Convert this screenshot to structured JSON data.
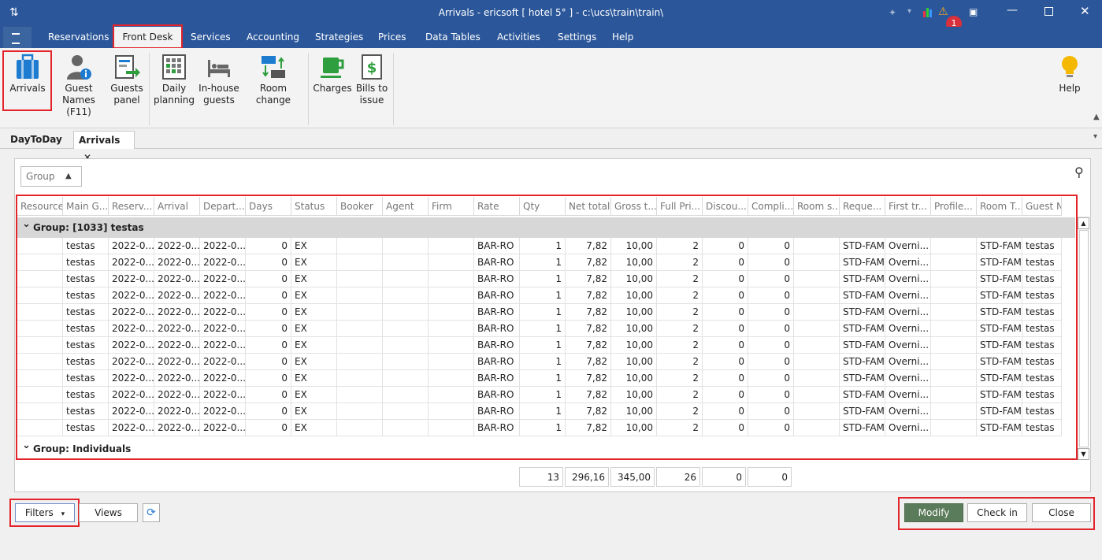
{
  "window": {
    "title": "Arrivals - ericsoft [ hotel 5° ] - c:\\ucs\\train\\train\\",
    "notification_count": "1"
  },
  "menu": [
    "Reservations",
    "Front Desk",
    "Services",
    "Accounting",
    "Strategies",
    "Prices",
    "Data Tables",
    "Activities",
    "Settings",
    "Help"
  ],
  "ribbon": {
    "arrivals": "Arrivals",
    "guest_names_1": "Guest Names",
    "guest_names_2": "(F11)",
    "guests_panel_1": "Guests",
    "guests_panel_2": "panel",
    "daily_planning_1": "Daily",
    "daily_planning_2": "planning",
    "inhouse_1": "In-house",
    "inhouse_2": "guests",
    "room_change": "Room change",
    "charges": "Charges",
    "bills_1": "Bills to",
    "bills_2": "issue",
    "help": "Help"
  },
  "tabs": {
    "daytoday": "DayToDay",
    "arrivals": "Arrivals"
  },
  "group_box": "Group",
  "columns": [
    "Resource",
    "Main G...",
    "Reserv...",
    "Arrival",
    "Depart...",
    "Days",
    "Status",
    "Booker",
    "Agent",
    "Firm",
    "Rate",
    "Qty",
    "Net total",
    "Gross t...",
    "Full Pri...",
    "Discou...",
    "Compli...",
    "Room s...",
    "Reque...",
    "First tr...",
    "Profile...",
    "Room T...",
    "Guest Na..."
  ],
  "group1_label": "Group:  [1033] testas",
  "group2_label": "Group: Individuals",
  "rows": [
    [
      "",
      "testas",
      "2022-0...",
      "2022-0...",
      "2022-0...",
      "0",
      "EX",
      "",
      "",
      "",
      "BAR-RO",
      "1",
      "7,82",
      "10,00",
      "2",
      "0",
      "0",
      "",
      "STD-FAM",
      "Overni...",
      "",
      "STD-FAM",
      "testas"
    ],
    [
      "",
      "testas",
      "2022-0...",
      "2022-0...",
      "2022-0...",
      "0",
      "EX",
      "",
      "",
      "",
      "BAR-RO",
      "1",
      "7,82",
      "10,00",
      "2",
      "0",
      "0",
      "",
      "STD-FAM",
      "Overni...",
      "",
      "STD-FAM",
      "testas"
    ],
    [
      "",
      "testas",
      "2022-0...",
      "2022-0...",
      "2022-0...",
      "0",
      "EX",
      "",
      "",
      "",
      "BAR-RO",
      "1",
      "7,82",
      "10,00",
      "2",
      "0",
      "0",
      "",
      "STD-FAM",
      "Overni...",
      "",
      "STD-FAM",
      "testas"
    ],
    [
      "",
      "testas",
      "2022-0...",
      "2022-0...",
      "2022-0...",
      "0",
      "EX",
      "",
      "",
      "",
      "BAR-RO",
      "1",
      "7,82",
      "10,00",
      "2",
      "0",
      "0",
      "",
      "STD-FAM",
      "Overni...",
      "",
      "STD-FAM",
      "testas"
    ],
    [
      "",
      "testas",
      "2022-0...",
      "2022-0...",
      "2022-0...",
      "0",
      "EX",
      "",
      "",
      "",
      "BAR-RO",
      "1",
      "7,82",
      "10,00",
      "2",
      "0",
      "0",
      "",
      "STD-FAM",
      "Overni...",
      "",
      "STD-FAM",
      "testas"
    ],
    [
      "",
      "testas",
      "2022-0...",
      "2022-0...",
      "2022-0...",
      "0",
      "EX",
      "",
      "",
      "",
      "BAR-RO",
      "1",
      "7,82",
      "10,00",
      "2",
      "0",
      "0",
      "",
      "STD-FAM",
      "Overni...",
      "",
      "STD-FAM",
      "testas"
    ],
    [
      "",
      "testas",
      "2022-0...",
      "2022-0...",
      "2022-0...",
      "0",
      "EX",
      "",
      "",
      "",
      "BAR-RO",
      "1",
      "7,82",
      "10,00",
      "2",
      "0",
      "0",
      "",
      "STD-FAM",
      "Overni...",
      "",
      "STD-FAM",
      "testas"
    ],
    [
      "",
      "testas",
      "2022-0...",
      "2022-0...",
      "2022-0...",
      "0",
      "EX",
      "",
      "",
      "",
      "BAR-RO",
      "1",
      "7,82",
      "10,00",
      "2",
      "0",
      "0",
      "",
      "STD-FAM",
      "Overni...",
      "",
      "STD-FAM",
      "testas"
    ],
    [
      "",
      "testas",
      "2022-0...",
      "2022-0...",
      "2022-0...",
      "0",
      "EX",
      "",
      "",
      "",
      "BAR-RO",
      "1",
      "7,82",
      "10,00",
      "2",
      "0",
      "0",
      "",
      "STD-FAM",
      "Overni...",
      "",
      "STD-FAM",
      "testas"
    ],
    [
      "",
      "testas",
      "2022-0...",
      "2022-0...",
      "2022-0...",
      "0",
      "EX",
      "",
      "",
      "",
      "BAR-RO",
      "1",
      "7,82",
      "10,00",
      "2",
      "0",
      "0",
      "",
      "STD-FAM",
      "Overni...",
      "",
      "STD-FAM",
      "testas"
    ],
    [
      "",
      "testas",
      "2022-0...",
      "2022-0...",
      "2022-0...",
      "0",
      "EX",
      "",
      "",
      "",
      "BAR-RO",
      "1",
      "7,82",
      "10,00",
      "2",
      "0",
      "0",
      "",
      "STD-FAM",
      "Overni...",
      "",
      "STD-FAM",
      "testas"
    ],
    [
      "",
      "testas",
      "2022-0...",
      "2022-0...",
      "2022-0...",
      "0",
      "EX",
      "",
      "",
      "",
      "BAR-RO",
      "1",
      "7,82",
      "10,00",
      "2",
      "0",
      "0",
      "",
      "STD-FAM",
      "Overni...",
      "",
      "STD-FAM",
      "testas"
    ]
  ],
  "totals": {
    "qty": "13",
    "net": "296,16",
    "gross": "345,00",
    "full": "26",
    "discount": "0",
    "compli": "0"
  },
  "buttons": {
    "filters": "Filters",
    "views": "Views",
    "modify": "Modify",
    "checkin": "Check in",
    "close": "Close"
  },
  "colors": {
    "titlebar": "#2b579a",
    "highlight": "#e3242b",
    "modify": "#5b7c5a"
  }
}
